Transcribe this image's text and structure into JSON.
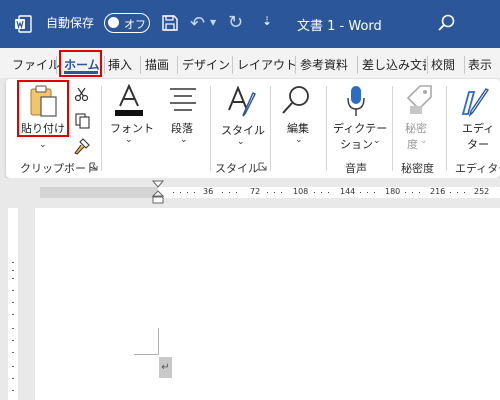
{
  "titlebar": {
    "autosave_label": "自動保存",
    "autosave_state": "オフ",
    "doc_title": "文書 1  -  Word",
    "qat_more": "⇣",
    "undo_glyph": "↶",
    "redo_glyph": "↻",
    "colors": {
      "bar": "#2b579a",
      "text": "#ffffff"
    }
  },
  "tabs": [
    {
      "label": "ファイル",
      "active": false
    },
    {
      "label": "ホーム",
      "active": true
    },
    {
      "label": "挿入",
      "active": false
    },
    {
      "label": "描画",
      "active": false
    },
    {
      "label": "デザイン",
      "active": false
    },
    {
      "label": "レイアウト",
      "active": false
    },
    {
      "label": "参考資料",
      "active": false
    },
    {
      "label": "差し込み文書",
      "active": false
    },
    {
      "label": "校閲",
      "active": false
    },
    {
      "label": "表示",
      "active": false
    }
  ],
  "ribbon": {
    "paste_label": "貼り付け",
    "font_label": "フォント",
    "paragraph_label": "段落",
    "style_label": "スタイル",
    "edit_label": "編集",
    "dictate_label_1": "ディクテー",
    "dictate_label_2": "ション",
    "sensitivity_label_1": "秘密",
    "sensitivity_label_2": "度",
    "editor_label_1": "エディ",
    "editor_label_2": "ター",
    "groups": {
      "clipboard": "クリップボード",
      "style": "スタイル",
      "voice": "音声",
      "sensitivity": "秘密度",
      "editor": "エディター"
    },
    "icons": [
      "clipboard-paste-icon",
      "scissors-icon",
      "copy-icon",
      "format-painter-icon",
      "font-color-icon",
      "paragraph-align-icon",
      "styles-icon",
      "search-magnifier-icon",
      "microphone-icon",
      "sensitivity-tag-icon",
      "editor-pen-icon",
      "dialog-launcher-icon"
    ],
    "highlight_color": "#e00000"
  },
  "ruler": {
    "numbers": [
      "36",
      "72",
      "108",
      "144",
      "180",
      "216",
      "252"
    ]
  },
  "document": {
    "paragraph_mark": "↵"
  }
}
